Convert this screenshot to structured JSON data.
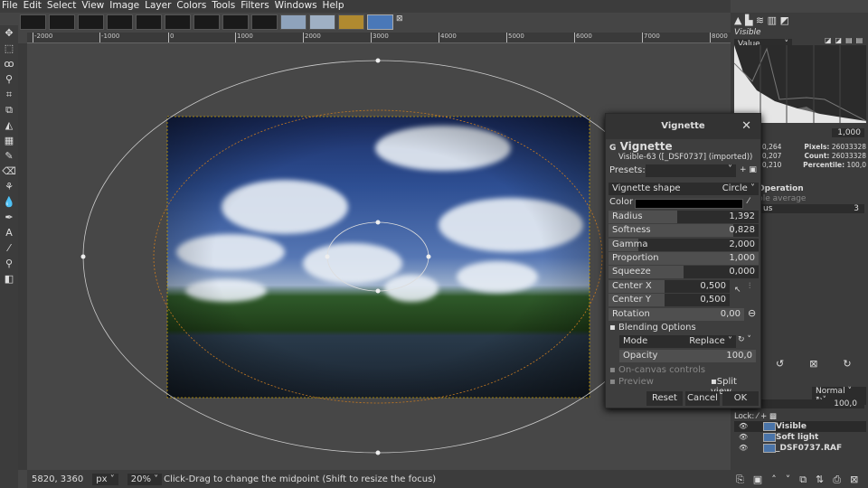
{
  "menu": [
    "File",
    "Edit",
    "Select",
    "View",
    "Image",
    "Layer",
    "Colors",
    "Tools",
    "Filters",
    "Windows",
    "Help"
  ],
  "ruler": [
    "-2000",
    "-1000",
    "0",
    "1000",
    "2000",
    "3000",
    "4000",
    "5000",
    "6000",
    "7000",
    "8000"
  ],
  "status": {
    "coords": "5820, 3360",
    "unit": "px",
    "zoom": "20%",
    "message": "Click-Drag to change the midpoint (Shift to resize the focus)"
  },
  "dialog": {
    "title": "Vignette",
    "heading": "Vignette",
    "subtitle": "Visible-63 ([_DSF0737] (imported))",
    "presets_label": "Presets:",
    "shape_label": "Vignette shape",
    "shape_value": "Circle",
    "color_label": "Color",
    "params": [
      {
        "label": "Radius",
        "value": "1,392",
        "fill": 0.46
      },
      {
        "label": "Softness",
        "value": "0,828",
        "fill": 0.83
      },
      {
        "label": "Gamma",
        "value": "2,000",
        "fill": 0.2
      },
      {
        "label": "Proportion",
        "value": "1,000",
        "fill": 1.0
      },
      {
        "label": "Squeeze",
        "value": "0,000",
        "fill": 0.5
      }
    ],
    "center_x_label": "Center X",
    "center_x": "0,500",
    "center_y_label": "Center Y",
    "center_y": "0,500",
    "rotation_label": "Rotation",
    "rotation": "0,00",
    "blending": "Blending Options",
    "mode_label": "Mode",
    "mode_value": "Replace",
    "opacity_label": "Opacity",
    "opacity": "100,0",
    "on_canvas": "On-canvas controls",
    "preview": "Preview",
    "split_view": "Split view",
    "reset": "Reset",
    "cancel": "Cancel",
    "ok": "OK"
  },
  "histogram": {
    "title": "Visible",
    "channel": "Value",
    "range_end": "1,000",
    "mean": ": 0,264",
    "stddev": ": 0,207",
    "median": ": 0,210",
    "pixels_label": "Pixels:",
    "pixels": "26033328",
    "count_label": "Count:",
    "count": "26033328",
    "percentile_label": "Percentile:",
    "percentile": "100,0"
  },
  "tool_options": {
    "operation": "Operation",
    "average": "ple average",
    "radius": "us",
    "radius_value": "3"
  },
  "layers": {
    "mode": "Normal",
    "opacity": "100,0",
    "lock": "Lock:",
    "items": [
      "Visible",
      "Soft light",
      "_DSF0737.RAF"
    ]
  }
}
